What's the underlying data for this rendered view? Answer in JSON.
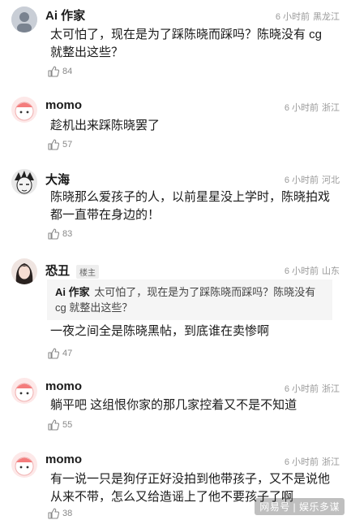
{
  "comments": [
    {
      "name": "Ai 作家",
      "time": "6 小时前",
      "location": "黑龙江",
      "text": "太可怕了，现在是为了踩陈晓而踩吗？陈晓没有 cg 就整出这些？",
      "likes": "84",
      "avatar": "ai-writer"
    },
    {
      "name": "momo",
      "time": "6 小时前",
      "location": "浙江",
      "text": "趁机出来踩陈晓罢了",
      "likes": "57",
      "avatar": "momo"
    },
    {
      "name": "大海",
      "time": "6 小时前",
      "location": "河北",
      "text": "陈晓那么爱孩子的人，以前星星没上学时，陈晓拍戏都一直带在身边的！",
      "likes": "83",
      "avatar": "dahai"
    },
    {
      "name": "恐丑",
      "badge": "楼主",
      "time": "6 小时前",
      "location": "山东",
      "quote_name": "Ai 作家",
      "quote_text": "太可怕了，现在是为了踩陈晓而踩吗？陈晓没有 cg 就整出这些？",
      "text": "一夜之间全是陈晓黑帖，到底谁在卖惨啊",
      "likes": "47",
      "avatar": "kongchou"
    },
    {
      "name": "momo",
      "time": "6 小时前",
      "location": "浙江",
      "text": "躺平吧 这组恨你家的那几家控着又不是不知道",
      "likes": "55",
      "avatar": "momo"
    },
    {
      "name": "momo",
      "time": "6 小时前",
      "location": "浙江",
      "text": "有一说一只是狗仔正好没拍到他带孩子，又不是说他从来不带，怎么又给造谣上了他不要孩子了啊",
      "likes": "38",
      "avatar": "momo"
    }
  ],
  "watermark": "网易号 | 娱乐多谋",
  "colors": {
    "name": "#1a1a1a",
    "meta": "#9a9a9a",
    "quote_bg": "#f5f5f5"
  }
}
